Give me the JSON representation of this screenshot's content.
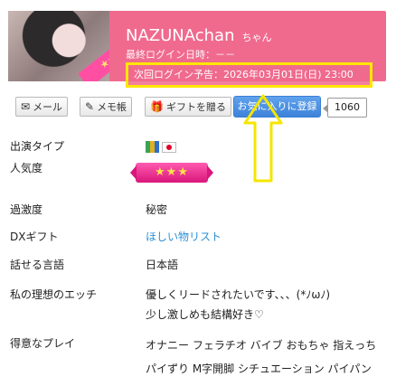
{
  "header": {
    "name": "NAZUNAchan",
    "name_suffix": "ちゃん",
    "last_login": "最終ログイン日時：－－",
    "next_login": "次回ログイン予告：2026年03月01日(日) 23:00",
    "avatar_ribbon": "★★",
    "header_color": "#f06a8e",
    "highlight_color": "#ffe600"
  },
  "actions": {
    "mail": {
      "icon": "mail-icon",
      "label": "メール"
    },
    "memo": {
      "icon": "memo-icon",
      "label": "メモ帳"
    },
    "gift": {
      "icon": "gift-icon",
      "label": "ギフトを贈る"
    },
    "favorite": {
      "label": "お気に入りに登録",
      "count": "1060"
    }
  },
  "profile": [
    {
      "label": "出演タイプ",
      "icons": [
        "map-icon",
        "japan-flag-icon"
      ]
    },
    {
      "label": "人気度",
      "badge": "★★★"
    },
    {
      "label": "過激度",
      "value": "秘密"
    },
    {
      "label": "DXギフト",
      "value": "ほしい物リスト",
      "is_link": true
    },
    {
      "label": "話せる言語",
      "value": "日本語"
    },
    {
      "label": "私の理想のエッチ",
      "value": "優しくリードされたいです、、、(*ﾉωﾉ)\n少し激しめも結構好き♡"
    },
    {
      "label": "得意なプレイ",
      "value": "オナニー フェラチオ バイブ おもちゃ 指えっち パイずり M字開脚 シチュエーション パイパン"
    }
  ]
}
